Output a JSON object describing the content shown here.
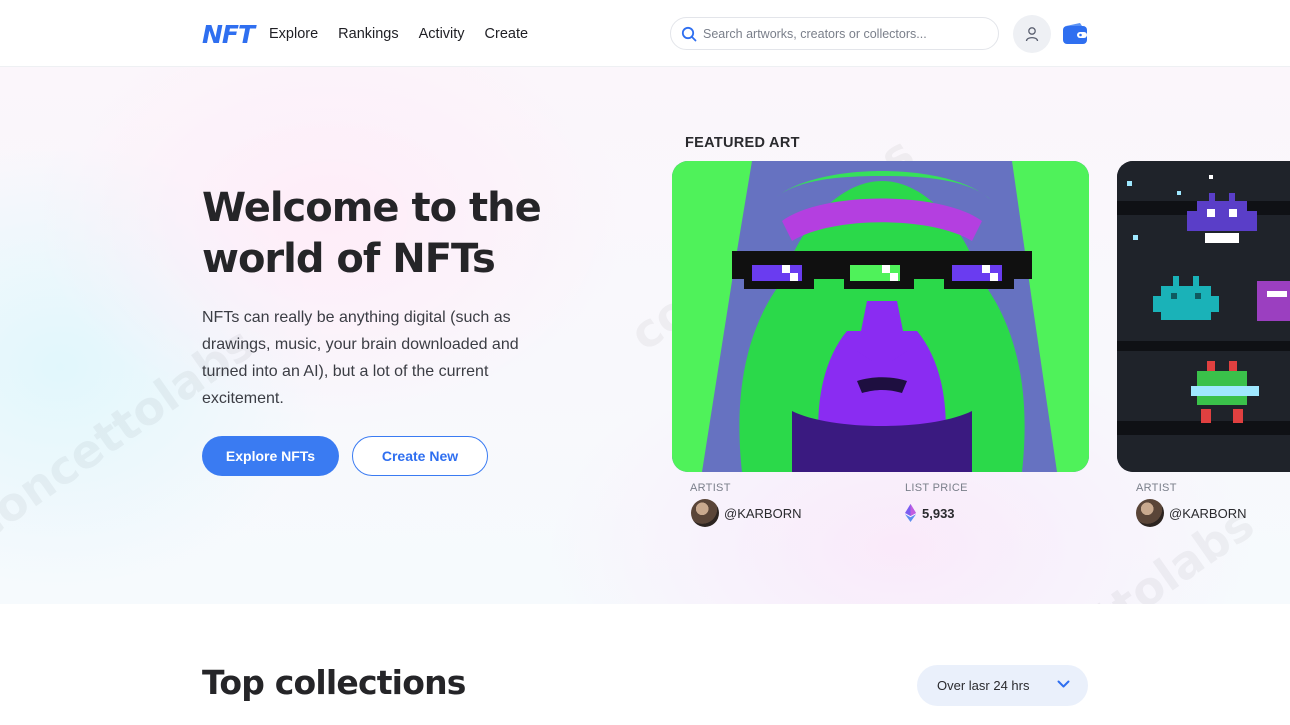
{
  "header": {
    "logo": "NFT",
    "nav": [
      "Explore",
      "Rankings",
      "Activity",
      "Create"
    ],
    "search_placeholder": "Search artworks, creators or collectors...",
    "icons": [
      "search-icon",
      "user-icon",
      "wallet-icon"
    ]
  },
  "hero": {
    "title": "Welcome to the world of NFTs",
    "description": "NFTs can really be anything digital (such as drawings, music, your brain downloaded and turned into an AI), but a lot of the current excitement.",
    "primary_button": "Explore NFTs",
    "secondary_button": "Create New"
  },
  "featured": {
    "label": "FEATURED ART",
    "cards": [
      {
        "artist_label": "ARTIST",
        "artist": "@KARBORN",
        "price_label": "LIST PRICE",
        "price": "5,933",
        "currency_icon": "ethereum-icon"
      },
      {
        "artist_label": "ARTIST",
        "artist": "@KARBORN"
      }
    ]
  },
  "collections": {
    "title": "Top collections",
    "range": "Over lasr 24 hrs"
  },
  "colors": {
    "accent": "#3a7bf2",
    "text": "#252528"
  }
}
